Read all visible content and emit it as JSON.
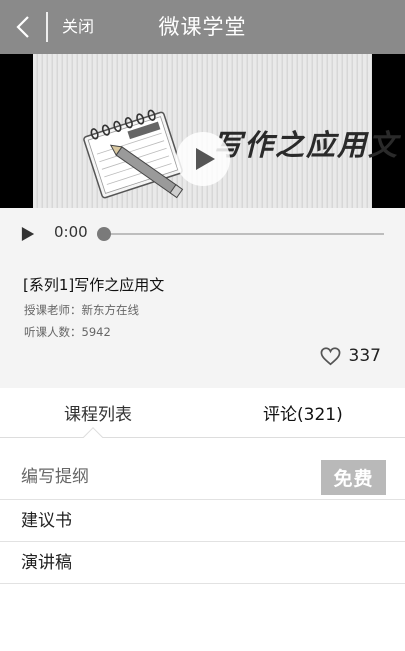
{
  "header": {
    "close_label": "关闭",
    "title": "微课学堂"
  },
  "video": {
    "overlay_text": "写作之应用文",
    "notebook_label": "Notebook"
  },
  "audio": {
    "current_time": "0:00",
    "progress": 0
  },
  "course": {
    "title": "[系列1]写作之应用文",
    "teacher": "授课老师：新东方在线",
    "listeners": "听课人数：5942",
    "likes": "337"
  },
  "tabs": [
    {
      "label": "课程列表",
      "active": true
    },
    {
      "label": "评论(321)",
      "active": false
    }
  ],
  "lessons": [
    {
      "label": "编写提纲",
      "badge": "免费"
    },
    {
      "label": "建议书"
    },
    {
      "label": "演讲稿"
    }
  ],
  "colors": {
    "header_bg": "#8a8a8a",
    "badge_bg": "#b9b9b9",
    "panel_bg": "#f4f4f4"
  }
}
